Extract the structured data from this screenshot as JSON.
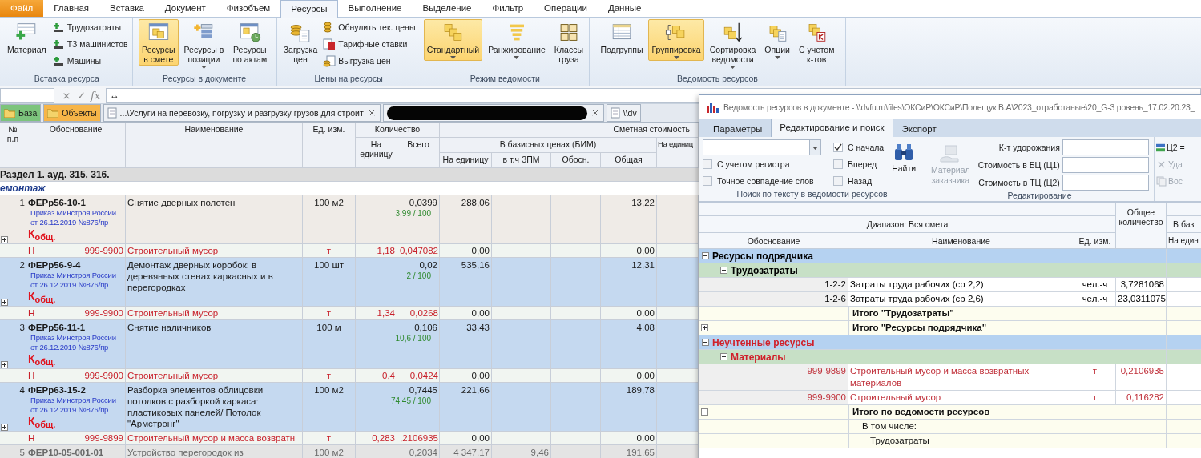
{
  "menu_tabs": [
    {
      "kind": "file",
      "label": "Файл",
      "selected": false
    },
    {
      "kind": "tab",
      "label": "Главная",
      "selected": false
    },
    {
      "kind": "tab",
      "label": "Вставка",
      "selected": false
    },
    {
      "kind": "tab",
      "label": "Документ",
      "selected": false
    },
    {
      "kind": "tab",
      "label": "Физобъем",
      "selected": false
    },
    {
      "kind": "tab",
      "label": "Ресурсы",
      "selected": true
    },
    {
      "kind": "tab",
      "label": "Выполнение",
      "selected": false
    },
    {
      "kind": "tab",
      "label": "Выделение",
      "selected": false
    },
    {
      "kind": "tab",
      "label": "Фильтр",
      "selected": false
    },
    {
      "kind": "tab",
      "label": "Операции",
      "selected": false
    },
    {
      "kind": "tab",
      "label": "Данные",
      "selected": false
    }
  ],
  "ribbon": {
    "groups": [
      {
        "label": "Вставка ресурса",
        "buttons": [
          {
            "kind": "big",
            "label": "Материал",
            "selected": false,
            "dropdown": false
          },
          {
            "kind": "small",
            "label": "Трудозатраты"
          },
          {
            "kind": "small",
            "label": "ТЗ машинистов"
          },
          {
            "kind": "small",
            "label": "Машины"
          }
        ]
      },
      {
        "label": "Ресурсы в документе",
        "buttons": [
          {
            "kind": "big",
            "label": "Ресурсы\nв смете",
            "selected": true,
            "dropdown": false
          },
          {
            "kind": "big",
            "label": "Ресурсы в\nпозиции",
            "selected": false,
            "dropdown": true
          },
          {
            "kind": "big",
            "label": "Ресурсы\nпо актам",
            "selected": false,
            "dropdown": false
          }
        ]
      },
      {
        "label": "Цены на ресурсы",
        "buttons": [
          {
            "kind": "big",
            "label": "Загрузка\nцен",
            "selected": false,
            "dropdown": false
          },
          {
            "kind": "small",
            "label": "Обнулить тек. цены"
          },
          {
            "kind": "small",
            "label": "Тарифные ставки"
          },
          {
            "kind": "small",
            "label": "Выгрузка цен"
          }
        ]
      },
      {
        "label": "Режим ведомости",
        "buttons": [
          {
            "kind": "big",
            "label": "Стандартный",
            "selected": true,
            "dropdown": true
          },
          {
            "kind": "big",
            "label": "Ранжирование",
            "selected": false,
            "dropdown": true
          },
          {
            "kind": "big",
            "label": "Классы\nгруза",
            "selected": false,
            "dropdown": false
          }
        ]
      },
      {
        "label": "Ведомость ресурсов",
        "buttons": [
          {
            "kind": "big",
            "label": "Подгруппы",
            "selected": false,
            "dropdown": false
          },
          {
            "kind": "big",
            "label": "Группировка",
            "selected": true,
            "dropdown": true
          },
          {
            "kind": "big",
            "label": "Сортировка\nведомости",
            "selected": false,
            "dropdown": true
          },
          {
            "kind": "big",
            "label": "Опции",
            "selected": false,
            "dropdown": true
          },
          {
            "kind": "big",
            "label": "С учетом\nк-тов",
            "selected": false,
            "dropdown": false
          }
        ]
      }
    ]
  },
  "formula_bar": {
    "cancel": "×",
    "confirm": "✓",
    "function": "fx",
    "value": "↔"
  },
  "doc_tabs": [
    {
      "kind": "folder",
      "label": "База",
      "color": "#7cc47c"
    },
    {
      "kind": "folder",
      "label": "Объекты",
      "color": "#f7b548"
    },
    {
      "kind": "doc",
      "label": "...\\Услуги на перевозку, погрузку и разгрузку грузов для строит",
      "closable": true
    },
    {
      "kind": "redacted",
      "closable": true
    },
    {
      "kind": "doc",
      "label": "\\\\dv",
      "closable": false
    }
  ],
  "estimate": {
    "headers": {
      "num": "№\nп.п",
      "basis": "Обоснование",
      "name": "Наименование",
      "unit": "Ед. изм.",
      "quantity": "Количество",
      "qty_per_unit": "На\nединицу",
      "qty_total": "Всего",
      "cost": "Сметная стоимость",
      "base_prices": "В базисных ценах (БИМ)",
      "price_per_unit": "На единицу",
      "zpm": "в т.ч ЗПМ",
      "reason": "Обосн.",
      "price_total": "Общая",
      "column_11": "На единиц"
    },
    "section": "Раздел 1. ауд. 315, 316.",
    "subsection": "емонтаж",
    "rows": [
      {
        "kind": "position",
        "num": "1",
        "code": "ФЕРр56-10-1",
        "order": "Приказ Минстроя России от 26.12.2019 №876/пр",
        "coef": "К$_{общ.}$",
        "name": "Снятие дверных полотен",
        "unit": "100 м2",
        "total": "0,0399",
        "ratio": "3,99 / 100",
        "price": "288,06",
        "sum": "13,22",
        "selected": false,
        "greyed": false
      },
      {
        "kind": "resource",
        "mark": "Н",
        "code": "999-9900",
        "name": "Строительный мусор",
        "unit": "т",
        "per_unit": "1,18",
        "total": "0,047082",
        "price": "0,00",
        "sum": "0,00"
      },
      {
        "kind": "position",
        "num": "2",
        "code": "ФЕРр56-9-4",
        "order": "Приказ Минстроя России от 26.12.2019 №876/пр",
        "coef": "К$_{общ.}$",
        "name": "Демонтаж дверных коробок: в деревянных стенах каркасных и в перегородках",
        "unit": "100 шт",
        "total": "0,02",
        "ratio": "2 / 100",
        "price": "535,16",
        "sum": "12,31",
        "selected": true,
        "greyed": false
      },
      {
        "kind": "resource",
        "mark": "Н",
        "code": "999-9900",
        "name": "Строительный мусор",
        "unit": "т",
        "per_unit": "1,34",
        "total": "0,0268",
        "price": "0,00",
        "sum": "0,00"
      },
      {
        "kind": "position",
        "num": "3",
        "code": "ФЕРр56-11-1",
        "order": "Приказ Минстроя России от 26.12.2019 №876/пр",
        "coef": "К$_{общ.}$",
        "name": "Снятие наличников",
        "unit": "100 м",
        "total": "0,106",
        "ratio": "10,6 / 100",
        "price": "33,43",
        "sum": "4,08",
        "selected": true,
        "greyed": false
      },
      {
        "kind": "resource",
        "mark": "Н",
        "code": "999-9900",
        "name": "Строительный мусор",
        "unit": "т",
        "per_unit": "0,4",
        "total": "0,0424",
        "price": "0,00",
        "sum": "0,00"
      },
      {
        "kind": "position",
        "num": "4",
        "code": "ФЕРр63-15-2",
        "order": "Приказ Минстроя России от 26.12.2019 №876/пр",
        "coef": "К$_{общ.}$",
        "name": "Разборка элементов облицовки потолков с разборкой каркаса: пластиковых панелей/ Потолок \"Армстронг\"",
        "unit": "100 м2",
        "total": "0,7445",
        "ratio": "74,45 / 100",
        "price": "221,66",
        "sum": "189,78",
        "selected": true,
        "greyed": false
      },
      {
        "kind": "resource",
        "mark": "Н",
        "code": "999-9899",
        "name": "Строительный мусор и масса возвратн",
        "unit": "т",
        "per_unit": "0,283",
        "total": ",2106935",
        "price": "0,00",
        "sum": "0,00"
      },
      {
        "kind": "position",
        "num": "5",
        "code": "ФЕР10-05-001-01",
        "name": "Устройство перегородок из",
        "unit": "100 м2",
        "total": "0,2034",
        "price": "4 347,17",
        "zpm": "9,46",
        "sum": "191,65",
        "selected": false,
        "greyed": true
      }
    ]
  },
  "dialog": {
    "title": "Ведомость ресурсов в документе - \\\\dvfu.ru\\files\\ОКСиР\\ОКСиР\\Полещук В.А\\2023_отработаные\\20_G-3 ровень_17.02.20.23_",
    "tabs": [
      {
        "label": "Параметры",
        "selected": false
      },
      {
        "label": "Редактирование и поиск",
        "selected": true
      },
      {
        "label": "Экспорт",
        "selected": false
      }
    ],
    "search": {
      "options": [
        {
          "label": "С учетом регистра",
          "checked": false
        },
        {
          "label": "Точное совпадение слов",
          "checked": false
        }
      ],
      "direction": [
        {
          "label": "С начала",
          "checked": true
        },
        {
          "label": "Вперед",
          "checked": false
        },
        {
          "label": "Назад",
          "checked": false
        }
      ],
      "find": "Найти",
      "group": "Поиск по тексту в ведомости ресурсов"
    },
    "editing": {
      "customer_material": {
        "label": "Материал\nзаказчика",
        "disabled": true
      },
      "fields": [
        {
          "label": "К-т удорожания"
        },
        {
          "label": "Стоимость в БЦ (Ц1)"
        },
        {
          "label": "Стоимость в ТЦ (Ц2)"
        }
      ],
      "group": "Редактирование"
    },
    "extra": [
      {
        "label": "Ц2 =",
        "disabled": false
      },
      {
        "label": "Уда",
        "disabled": true
      },
      {
        "label": "Вос",
        "disabled": true
      }
    ],
    "headers": {
      "range": "Диапазон: Вся смета",
      "total_qty": "Общее\nколичество",
      "column_5": "В баз",
      "basis": "Обоснование",
      "name": "Наименование",
      "unit": "Ед. изм.",
      "column_5_sub": "На един"
    },
    "rows": [
      {
        "kind": "group",
        "label": "Ресурсы подрядчика",
        "expanded": true,
        "color": "#000000"
      },
      {
        "kind": "subgroup",
        "label": "Трудозатраты",
        "expanded": true,
        "color": "#000000"
      },
      {
        "kind": "item",
        "code": "1-2-2",
        "name": "Затраты труда рабочих (ср 2,2)",
        "unit": "чел.-ч",
        "qty": "3,7281068",
        "color": "#000000"
      },
      {
        "kind": "item",
        "code": "1-2-6",
        "name": "Затраты труда рабочих (ср 2,6)",
        "unit": "чел.-ч",
        "qty": "23,0311075",
        "color": "#000000"
      },
      {
        "kind": "total",
        "label": "Итого \"Трудозатраты\""
      },
      {
        "kind": "total",
        "label": "Итого \"Ресурсы подрядчика\"",
        "expanded": false
      },
      {
        "kind": "group",
        "label": "Неучтенные ресурсы",
        "expanded": true,
        "color": "#d0202a"
      },
      {
        "kind": "subgroup",
        "label": "Материалы",
        "expanded": true,
        "color": "#d0202a"
      },
      {
        "kind": "item",
        "code": "999-9899",
        "name": "Строительный мусор и масса возвратных материалов",
        "unit": "т",
        "qty": "0,2106935",
        "color": "#c0303a"
      },
      {
        "kind": "item",
        "code": "999-9900",
        "name": "Строительный мусор",
        "unit": "т",
        "qty": "0,116282",
        "color": "#c0303a"
      },
      {
        "kind": "total",
        "label": "Итого по ведомости ресурсов",
        "expanded": true
      },
      {
        "kind": "note",
        "label": "В том числе:"
      },
      {
        "kind": "subnote",
        "label": "Трудозатраты"
      }
    ]
  }
}
